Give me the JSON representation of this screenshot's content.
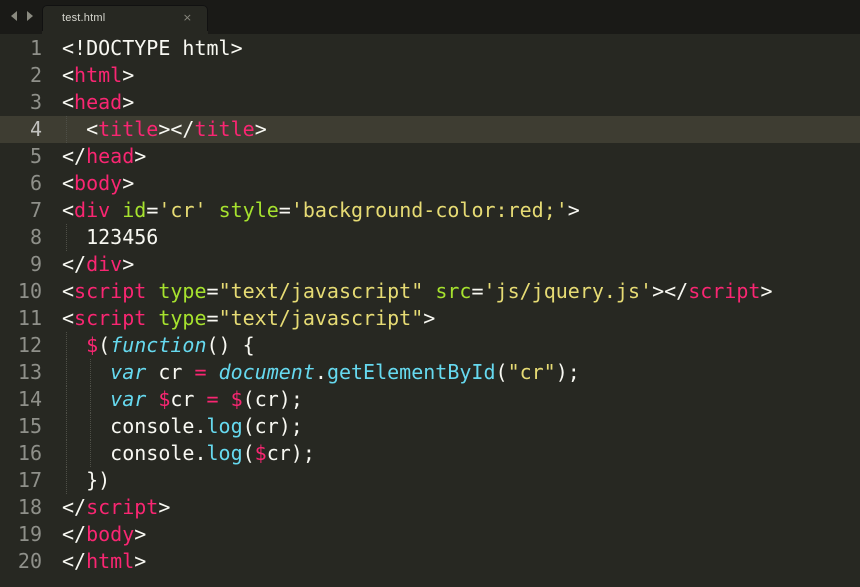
{
  "tabbar": {
    "back_icon": "chevron-left-icon",
    "forward_icon": "chevron-right-icon",
    "tab": {
      "label": "test.html",
      "close": "×"
    }
  },
  "editor": {
    "current_line": 4,
    "colors": {
      "background": "#272822",
      "current_line": "#3e3d32",
      "gutter": "#8f908a",
      "plain": "#f8f8f2",
      "tag": "#f92672",
      "attribute": "#a6e22e",
      "string": "#e6db74",
      "keyword": "#66d9ef"
    },
    "lines": [
      {
        "num": "1",
        "tokens": [
          [
            "plain",
            "<!DOCTYPE html>"
          ]
        ]
      },
      {
        "num": "2",
        "tokens": [
          [
            "plain",
            "<"
          ],
          [
            "tag",
            "html"
          ],
          [
            "plain",
            ">"
          ]
        ]
      },
      {
        "num": "3",
        "tokens": [
          [
            "plain",
            "<"
          ],
          [
            "tag",
            "head"
          ],
          [
            "plain",
            ">"
          ]
        ]
      },
      {
        "num": "4",
        "tokens": [
          [
            "plain",
            "  <"
          ],
          [
            "tag",
            "title"
          ],
          [
            "plain",
            "></"
          ],
          [
            "tag",
            "title"
          ],
          [
            "plain",
            ">"
          ]
        ]
      },
      {
        "num": "5",
        "tokens": [
          [
            "plain",
            "</"
          ],
          [
            "tag",
            "head"
          ],
          [
            "plain",
            ">"
          ]
        ]
      },
      {
        "num": "6",
        "tokens": [
          [
            "plain",
            "<"
          ],
          [
            "tag",
            "body"
          ],
          [
            "plain",
            ">"
          ]
        ]
      },
      {
        "num": "7",
        "tokens": [
          [
            "plain",
            "<"
          ],
          [
            "tag",
            "div"
          ],
          [
            "plain",
            " "
          ],
          [
            "attr",
            "id"
          ],
          [
            "plain",
            "="
          ],
          [
            "str",
            "'cr'"
          ],
          [
            "plain",
            " "
          ],
          [
            "attr",
            "style"
          ],
          [
            "plain",
            "="
          ],
          [
            "str",
            "'background-color:red;'"
          ],
          [
            "plain",
            ">"
          ]
        ]
      },
      {
        "num": "8",
        "tokens": [
          [
            "plain",
            "  123456"
          ]
        ]
      },
      {
        "num": "9",
        "tokens": [
          [
            "plain",
            "</"
          ],
          [
            "tag",
            "div"
          ],
          [
            "plain",
            ">"
          ]
        ]
      },
      {
        "num": "10",
        "tokens": [
          [
            "plain",
            "<"
          ],
          [
            "tag",
            "script"
          ],
          [
            "plain",
            " "
          ],
          [
            "attr",
            "type"
          ],
          [
            "plain",
            "="
          ],
          [
            "str",
            "\"text/javascript\""
          ],
          [
            "plain",
            " "
          ],
          [
            "attr",
            "src"
          ],
          [
            "plain",
            "="
          ],
          [
            "str",
            "'js/jquery.js'"
          ],
          [
            "plain",
            "></"
          ],
          [
            "tag",
            "script"
          ],
          [
            "plain",
            ">"
          ]
        ]
      },
      {
        "num": "11",
        "tokens": [
          [
            "plain",
            "<"
          ],
          [
            "tag",
            "script"
          ],
          [
            "plain",
            " "
          ],
          [
            "attr",
            "type"
          ],
          [
            "plain",
            "="
          ],
          [
            "str",
            "\"text/javascript\""
          ],
          [
            "plain",
            ">"
          ]
        ]
      },
      {
        "num": "12",
        "tokens": [
          [
            "plain",
            "  "
          ],
          [
            "dollar",
            "$"
          ],
          [
            "plain",
            "("
          ],
          [
            "kw",
            "function"
          ],
          [
            "plain",
            "() {"
          ]
        ]
      },
      {
        "num": "13",
        "tokens": [
          [
            "plain",
            "    "
          ],
          [
            "kw",
            "var"
          ],
          [
            "plain",
            " cr "
          ],
          [
            "op",
            "="
          ],
          [
            "plain",
            " "
          ],
          [
            "kw",
            "document"
          ],
          [
            "plain",
            "."
          ],
          [
            "fn",
            "getElementById"
          ],
          [
            "plain",
            "("
          ],
          [
            "str",
            "\"cr\""
          ],
          [
            "plain",
            ");"
          ]
        ]
      },
      {
        "num": "14",
        "tokens": [
          [
            "plain",
            "    "
          ],
          [
            "kw",
            "var"
          ],
          [
            "plain",
            " "
          ],
          [
            "dollar",
            "$"
          ],
          [
            "plain",
            "cr "
          ],
          [
            "op",
            "="
          ],
          [
            "plain",
            " "
          ],
          [
            "dollar",
            "$"
          ],
          [
            "plain",
            "(cr);"
          ]
        ]
      },
      {
        "num": "15",
        "tokens": [
          [
            "plain",
            "    console."
          ],
          [
            "fn",
            "log"
          ],
          [
            "plain",
            "(cr);"
          ]
        ]
      },
      {
        "num": "16",
        "tokens": [
          [
            "plain",
            "    console."
          ],
          [
            "fn",
            "log"
          ],
          [
            "plain",
            "("
          ],
          [
            "dollar",
            "$"
          ],
          [
            "plain",
            "cr);"
          ]
        ]
      },
      {
        "num": "17",
        "tokens": [
          [
            "plain",
            "  })"
          ]
        ]
      },
      {
        "num": "18",
        "tokens": [
          [
            "plain",
            "</"
          ],
          [
            "tag",
            "script"
          ],
          [
            "plain",
            ">"
          ]
        ]
      },
      {
        "num": "19",
        "tokens": [
          [
            "plain",
            "</"
          ],
          [
            "tag",
            "body"
          ],
          [
            "plain",
            ">"
          ]
        ]
      },
      {
        "num": "20",
        "tokens": [
          [
            "plain",
            "</"
          ],
          [
            "tag",
            "html"
          ],
          [
            "plain",
            ">"
          ]
        ]
      }
    ]
  }
}
